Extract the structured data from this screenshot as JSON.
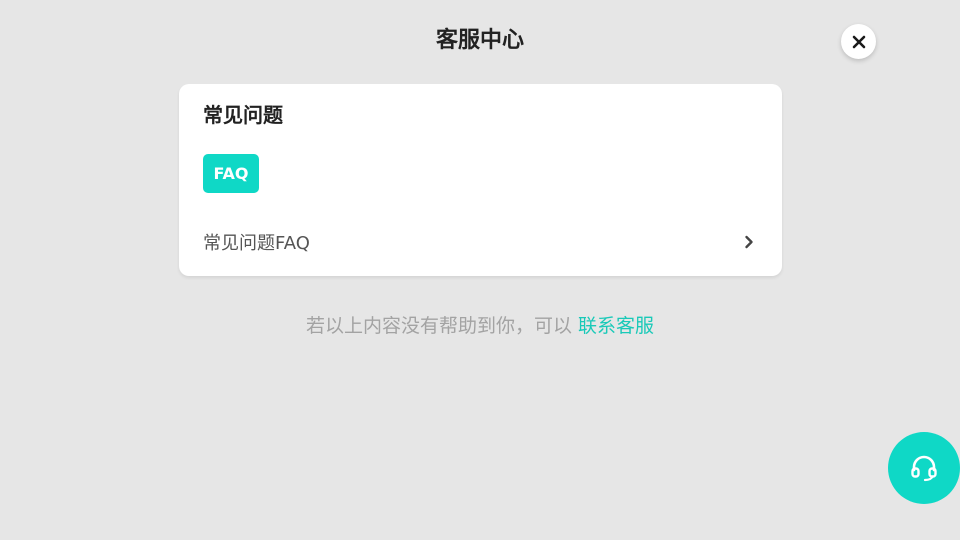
{
  "header": {
    "title": "客服中心",
    "close_icon": "close-icon"
  },
  "faq_card": {
    "title": "常见问题",
    "tag_label": "FAQ",
    "row_label": "常见问题FAQ",
    "row_icon": "chevron-right-icon"
  },
  "footer": {
    "note_text": "若以上内容没有帮助到你，可以 ",
    "contact_link": "联系客服"
  },
  "fab": {
    "icon": "headset-icon"
  },
  "colors": {
    "accent": "#0fd8c6",
    "background": "#e6e6e6",
    "card": "#ffffff",
    "link": "#19c9b8"
  }
}
